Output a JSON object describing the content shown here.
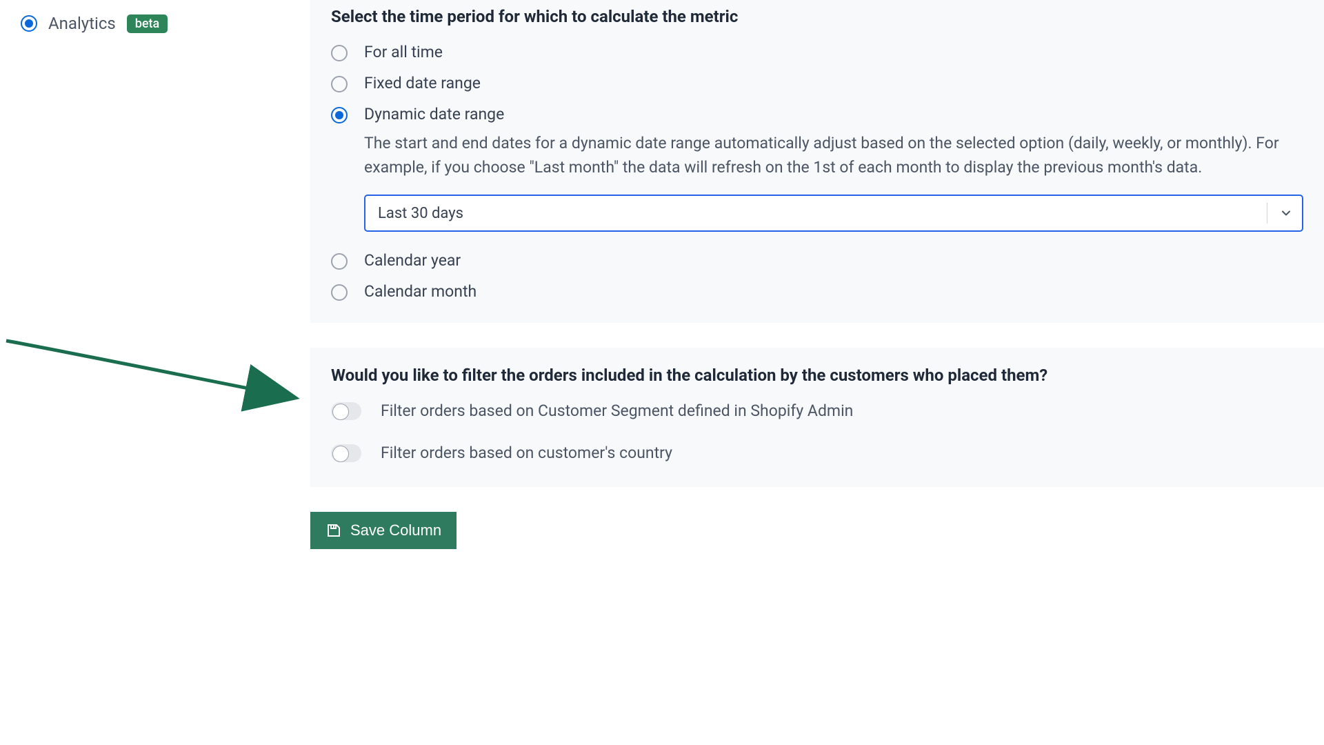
{
  "sidebar": {
    "analytics_label": "Analytics",
    "badge_label": "beta"
  },
  "time_section": {
    "heading": "Select the time period for which to calculate the metric",
    "options": [
      {
        "label": "For all time",
        "checked": false
      },
      {
        "label": "Fixed date range",
        "checked": false
      },
      {
        "label": "Dynamic date range",
        "checked": true
      },
      {
        "label": "Calendar year",
        "checked": false
      },
      {
        "label": "Calendar month",
        "checked": false
      }
    ],
    "dynamic_help": "The start and end dates for a dynamic date range automatically adjust based on the selected option (daily, weekly, or monthly). For example, if you choose \"Last month\" the data will refresh on the 1st of each month to display the previous month's data.",
    "dynamic_select_value": "Last 30 days"
  },
  "filter_section": {
    "heading": "Would you like to filter the orders included in the calculation by the customers who placed them?",
    "toggles": [
      {
        "label": "Filter orders based on Customer Segment defined in Shopify Admin",
        "on": false
      },
      {
        "label": "Filter orders based on customer's country",
        "on": false
      }
    ]
  },
  "actions": {
    "save_label": "Save Column"
  },
  "colors": {
    "accent": "#0969da",
    "brand_green": "#2f855a",
    "arrow": "#1a6e4f"
  }
}
